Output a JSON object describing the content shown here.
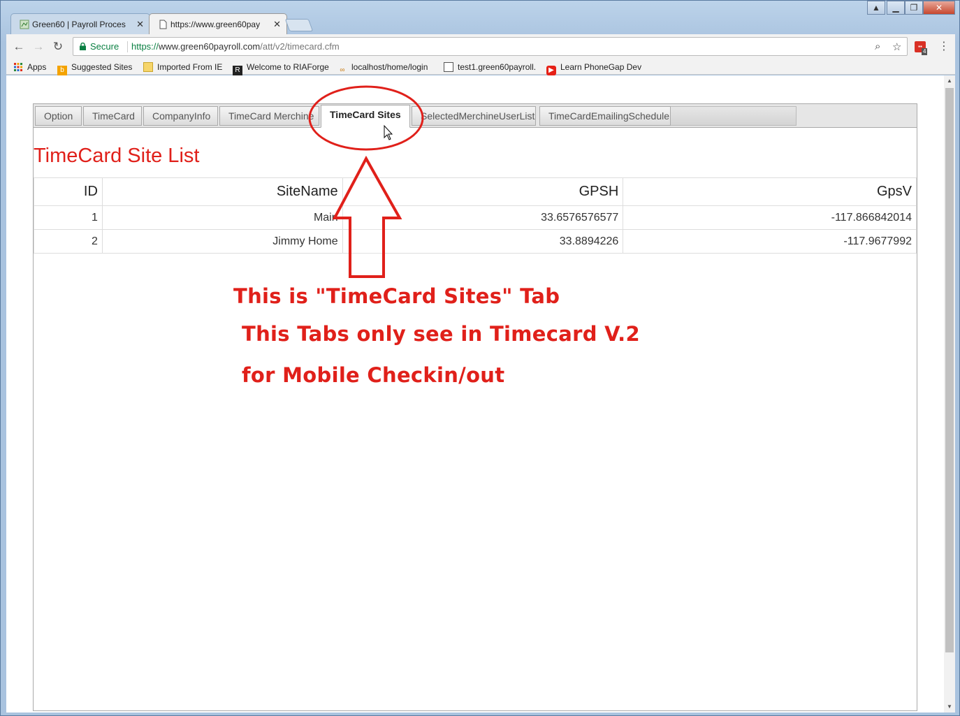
{
  "browser": {
    "tabs": [
      {
        "label": "Green60 | Payroll Proces"
      },
      {
        "label": "https://www.green60pay"
      }
    ],
    "close_glyph": "✕",
    "window_controls": {
      "minimize": "▁",
      "restore": "❐",
      "close": "✕"
    },
    "nav": {
      "back": "←",
      "forward": "→",
      "reload": "↻"
    },
    "address": {
      "secure_label": "Secure",
      "url_scheme": "https://",
      "url_host": "www.green60payroll.com",
      "url_path": "/att/v2/timecard.cfm"
    },
    "extension_badge": "4",
    "bookmarks": [
      {
        "label": "Apps",
        "icon": "apps-grid-icon"
      },
      {
        "label": "Suggested Sites",
        "icon": "bing-icon"
      },
      {
        "label": "Imported From IE",
        "icon": "folder-icon"
      },
      {
        "label": "Welcome to RIAForge",
        "icon": "riaforge-icon"
      },
      {
        "label": "localhost/home/login",
        "icon": "localhost-icon"
      },
      {
        "label": "test1.green60payroll.",
        "icon": "page-icon"
      },
      {
        "label": "Learn PhoneGap Dev",
        "icon": "youtube-icon"
      }
    ]
  },
  "app": {
    "tabs": [
      {
        "label": "Option"
      },
      {
        "label": "TimeCard"
      },
      {
        "label": "CompanyInfo"
      },
      {
        "label": "TimeCard Merchine"
      },
      {
        "label": "TimeCard Sites"
      },
      {
        "label": "SelectedMerchineUserList"
      },
      {
        "label": "TimeCardEmailingSchedule"
      }
    ],
    "active_tab": "TimeCard Sites",
    "list_title": "TimeCard Site List",
    "table": {
      "columns": [
        "ID",
        "SiteName",
        "GPSH",
        "GpsV"
      ],
      "rows": [
        [
          "1",
          "Main",
          "33.6576576577",
          "-117.866842014"
        ],
        [
          "2",
          "Jimmy Home",
          "33.8894226",
          "-117.9677992"
        ]
      ]
    }
  },
  "annotation": {
    "color": "#e0201a",
    "lines": [
      "This is \"TimeCard Sites\" Tab",
      "This Tabs only see in Timecard V.2",
      "for Mobile Checkin/out"
    ]
  }
}
